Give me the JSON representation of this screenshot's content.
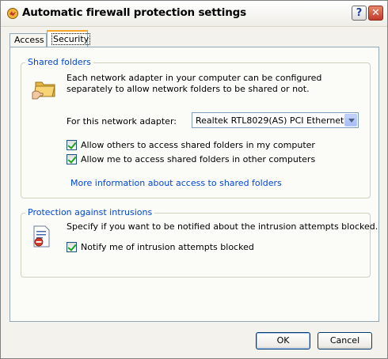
{
  "window": {
    "title": "Automatic firewall protection settings"
  },
  "titlebar_buttons": {
    "help": "?",
    "close": "✕"
  },
  "tabs": [
    {
      "label": "Access"
    },
    {
      "label": "Security"
    }
  ],
  "shared_folders": {
    "title": "Shared folders",
    "description": "Each network adapter in your computer can be configured separately to allow network folders to be shared or not.",
    "adapter_label": "For this network adapter:",
    "adapter_value": "Realtek RTL8029(AS) PCI Ethernet ââ",
    "checkboxes": [
      {
        "label": "Allow others to access shared folders in my computer",
        "checked": true
      },
      {
        "label": "Allow me to access shared folders in other computers",
        "checked": true
      }
    ],
    "link": "More information about access to shared folders"
  },
  "intrusions": {
    "title": "Protection against intrusions",
    "description": "Specify if you want to be notified about the intrusion attempts blocked.",
    "checkbox": {
      "label": "Notify me of intrusion attempts blocked",
      "checked": true
    }
  },
  "buttons": {
    "ok": "OK",
    "cancel": "Cancel"
  },
  "icons": {
    "app": "firewall-app-icon",
    "folder": "shared-folder-icon",
    "intrusion": "intrusion-log-icon"
  },
  "colors": {
    "link": "#0046d5",
    "group_title": "#0046d5",
    "tab_highlight": "#f7a52a"
  }
}
